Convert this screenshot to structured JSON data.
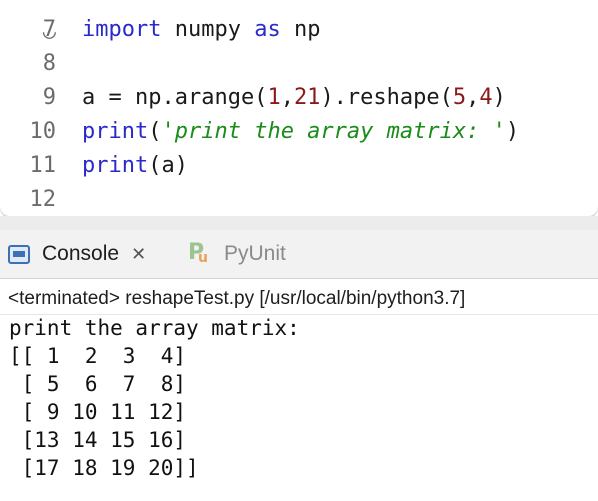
{
  "editor": {
    "lines": [
      {
        "num": "7",
        "tokens": [
          {
            "t": "import",
            "c": "kw"
          },
          {
            "t": " numpy ",
            "c": ""
          },
          {
            "t": "as",
            "c": "kw"
          },
          {
            "t": " np",
            "c": ""
          }
        ]
      },
      {
        "num": "8",
        "tokens": []
      },
      {
        "num": "9",
        "tokens": [
          {
            "t": "a = np.arange(",
            "c": ""
          },
          {
            "t": "1",
            "c": "num"
          },
          {
            "t": ",",
            "c": ""
          },
          {
            "t": "21",
            "c": "num"
          },
          {
            "t": ").reshape(",
            "c": ""
          },
          {
            "t": "5",
            "c": "num"
          },
          {
            "t": ",",
            "c": ""
          },
          {
            "t": "4",
            "c": "num"
          },
          {
            "t": ")",
            "c": ""
          }
        ]
      },
      {
        "num": "10",
        "tokens": [
          {
            "t": "print",
            "c": "kw"
          },
          {
            "t": "(",
            "c": ""
          },
          {
            "t": "'print the array matrix: '",
            "c": "str"
          },
          {
            "t": ")",
            "c": ""
          }
        ]
      },
      {
        "num": "11",
        "tokens": [
          {
            "t": "print",
            "c": "kw"
          },
          {
            "t": "(a)",
            "c": ""
          }
        ]
      },
      {
        "num": "12",
        "tokens": []
      }
    ]
  },
  "tabs": {
    "console_label": "Console",
    "close_glyph": "✕",
    "pyunit_label": "PyUnit"
  },
  "console": {
    "status": "<terminated> reshapeTest.py [/usr/local/bin/python3.7]",
    "output_lines": [
      "print the array matrix:",
      "[[ 1  2  3  4]",
      " [ 5  6  7  8]",
      " [ 9 10 11 12]",
      " [13 14 15 16]",
      " [17 18 19 20]]"
    ]
  }
}
